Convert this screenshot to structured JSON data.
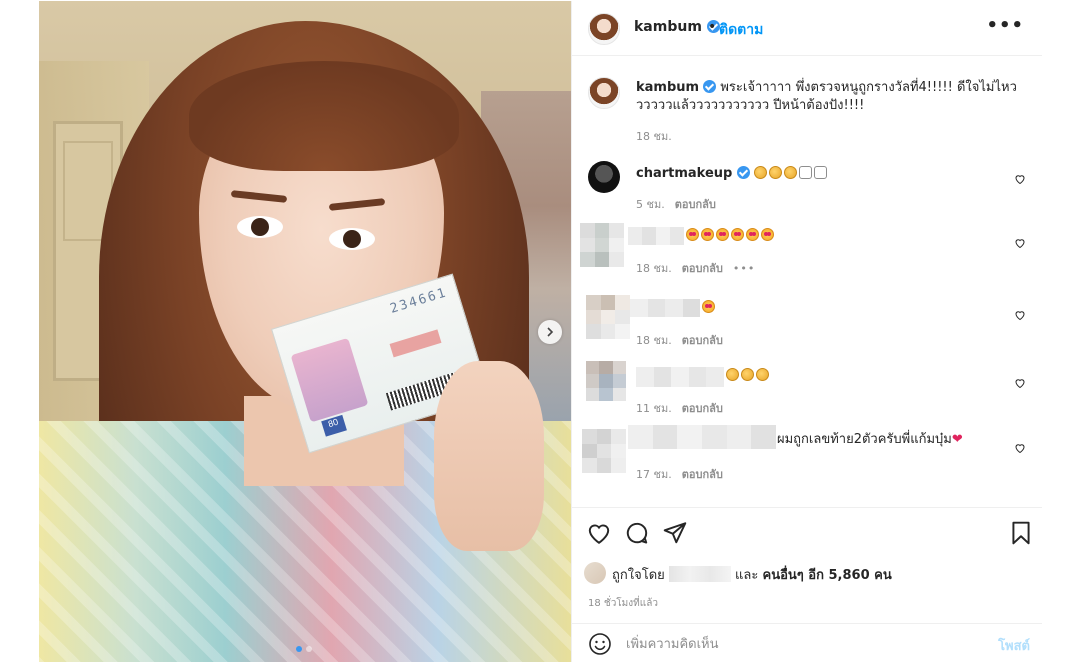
{
  "post": {
    "username": "kambum",
    "dot": "•",
    "follow_label": "ติดตาม",
    "more_icon": "more-horizontal-icon",
    "image_alt": "selfie-with-lottery-ticket",
    "ticket_number": "234661"
  },
  "caption": {
    "username": "kambum",
    "text": "พระเจ้าาาาา พึ่งตรวจหนูถูกรางวัลที่4!!!!! ดีใจไม่ไหววววววแล้ววววววววววว ปีหน้าต้องปัง!!!!",
    "time": "18 ชม."
  },
  "comments": [
    {
      "username": "chartmakeup",
      "verified": true,
      "time": "5 ชม.",
      "reply": "ตอบกลับ",
      "emoji": "👏👏👏👍👍"
    },
    {
      "username": "",
      "time": "18 ชม.",
      "reply": "ตอบกลับ",
      "more": "•••",
      "emoji": "😍😍😍😍😍😍"
    },
    {
      "username": "",
      "time": "18 ชม.",
      "reply": "ตอบกลับ",
      "emoji": "😍"
    },
    {
      "username": "",
      "time": "11 ชม.",
      "reply": "ตอบกลับ",
      "emoji": "👏👏👏"
    },
    {
      "username": "",
      "time": "17 ชม.",
      "reply": "ตอบกลับ",
      "text": "ผมถูกเลขท้าย2ตัวครับพี่แก้มบุ๋ม",
      "heart": "❤"
    }
  ],
  "likes": {
    "prefix": "ถูกใจโดย",
    "middle": "และ",
    "suffix": "คนอื่นๆ อีก 5,860 คน"
  },
  "time_ago": "18 ชั่วโมงที่แล้ว",
  "add_comment": {
    "placeholder": "เพิ่มความคิดเห็น",
    "post_label": "โพสต์"
  },
  "colors": {
    "accent": "#0095f6",
    "verified": "#3897f0",
    "muted": "#8e8e8e",
    "post_disabled": "#b2dffc"
  }
}
